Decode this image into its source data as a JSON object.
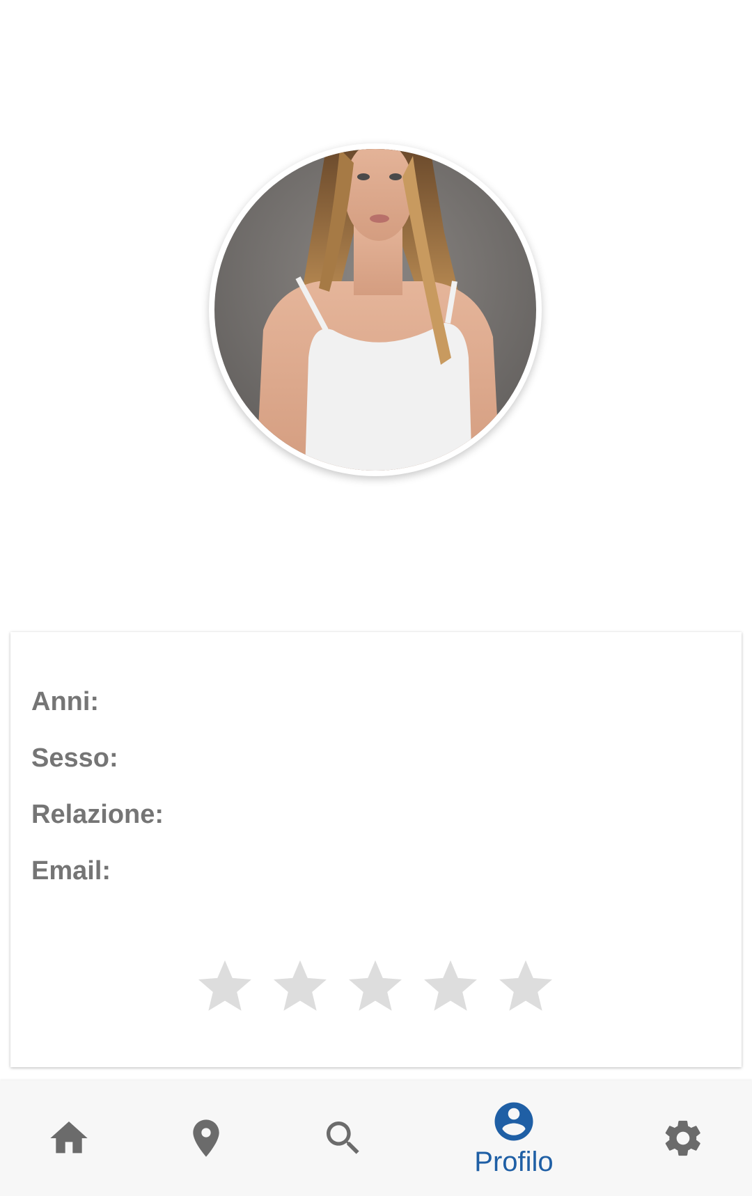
{
  "profile": {
    "fields": [
      {
        "label": "Anni:"
      },
      {
        "label": "Sesso:"
      },
      {
        "label": "Relazione:"
      },
      {
        "label": "Email:"
      }
    ],
    "rating": {
      "value": 0,
      "max": 5
    }
  },
  "bottom_nav": {
    "items": [
      {
        "icon": "home-icon"
      },
      {
        "icon": "location-pin-icon"
      },
      {
        "icon": "search-icon"
      },
      {
        "icon": "account-circle-icon",
        "label": "Profilo",
        "active": true
      },
      {
        "icon": "gear-icon"
      }
    ]
  },
  "colors": {
    "accent": "#1f5fa5",
    "icon_inactive": "#6b6b6b",
    "field_text": "#757575",
    "star_empty": "#dddddd"
  }
}
